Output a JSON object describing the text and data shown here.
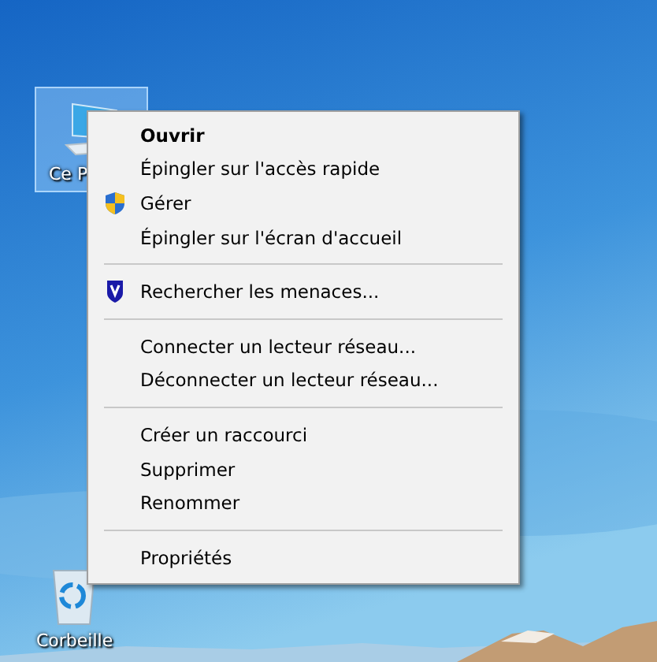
{
  "desktop_icons": [
    {
      "kind": "computer",
      "label": "Ce P",
      "selected": true
    },
    {
      "kind": "recycle-bin",
      "label": "Corbeille",
      "selected": false
    }
  ],
  "context_menu": {
    "items": [
      {
        "kind": "item",
        "label": "Ouvrir",
        "default": true
      },
      {
        "kind": "item",
        "label": "Épingler sur l'accès rapide",
        "default": false
      },
      {
        "kind": "admin-item",
        "label": "Gérer",
        "default": false
      },
      {
        "kind": "item",
        "label": "Épingler sur l'écran d'accueil",
        "default": false
      },
      {
        "kind": "separator"
      },
      {
        "kind": "scan-item",
        "label": "Rechercher les menaces...",
        "default": false
      },
      {
        "kind": "separator"
      },
      {
        "kind": "item",
        "label": "Connecter un lecteur réseau...",
        "default": false
      },
      {
        "kind": "item",
        "label": "Déconnecter un lecteur réseau...",
        "default": false
      },
      {
        "kind": "separator"
      },
      {
        "kind": "item",
        "label": "Créer un raccourci",
        "default": false
      },
      {
        "kind": "item",
        "label": "Supprimer",
        "default": false
      },
      {
        "kind": "item",
        "label": "Renommer",
        "default": false
      },
      {
        "kind": "separator"
      },
      {
        "kind": "item",
        "label": "Propriétés",
        "default": false
      }
    ]
  }
}
